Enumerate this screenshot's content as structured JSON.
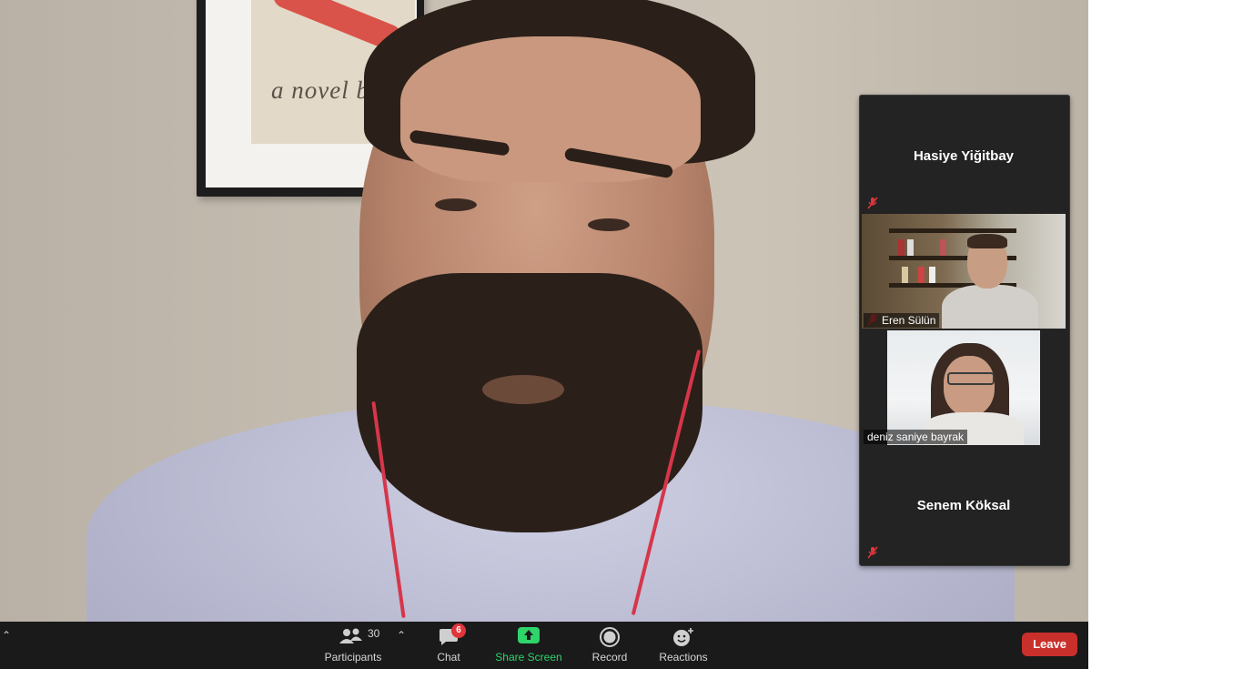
{
  "meeting": {
    "participants_tiles": [
      {
        "name": "Hasiye Yiğitbay",
        "video": false,
        "muted": true
      },
      {
        "name": "Eren Sülün",
        "video": true,
        "muted": true
      },
      {
        "name": "deniz saniye bayrak",
        "video": true,
        "muted": false
      },
      {
        "name": "Senem Köksal",
        "video": false,
        "muted": true
      }
    ],
    "background_poster_text": "a novel b"
  },
  "toolbar": {
    "participants_label": "Participants",
    "participants_count": "30",
    "chat_label": "Chat",
    "chat_badge": "6",
    "share_screen_label": "Share Screen",
    "record_label": "Record",
    "reactions_label": "Reactions",
    "leave_label": "Leave"
  },
  "colors": {
    "toolbar_bg": "#1a1a1a",
    "share_green": "#2fd46a",
    "leave_red": "#c9302c",
    "badge_red": "#e0353a",
    "panel_bg": "#232323"
  },
  "icons": {
    "participants": "people-icon",
    "chat": "chat-bubble-icon",
    "share": "share-screen-arrow-icon",
    "record": "record-circle-icon",
    "reactions": "smiley-plus-icon",
    "mute": "muted-mic-icon",
    "caret": "chevron-up-icon"
  }
}
